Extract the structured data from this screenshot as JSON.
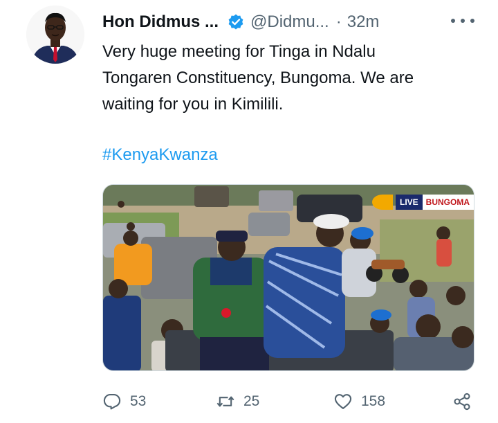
{
  "author": {
    "name": "Hon Didmus ...",
    "handle": "@Didmu...",
    "separator": "·",
    "time": "32m",
    "verified_color": "#1d9bf0"
  },
  "tweet": {
    "text_lines": [
      "Very huge meeting for Tinga in Ndalu",
      "Tongaren Constituency, Bungoma. We are",
      "waiting for you in Kimilili."
    ],
    "hashtag": "#KenyaKwanza"
  },
  "media": {
    "live_label": "LIVE",
    "location_label": "BUNGOMA"
  },
  "actions": {
    "replies": "53",
    "retweets": "25",
    "likes": "158"
  },
  "icons": {
    "more": "more-dots-icon",
    "reply": "reply-icon",
    "retweet": "retweet-icon",
    "like": "heart-icon",
    "share": "share-icon",
    "verified": "verified-badge-icon"
  },
  "colors": {
    "text": "#0f1419",
    "secondary": "#536471",
    "link": "#1d9bf0"
  }
}
